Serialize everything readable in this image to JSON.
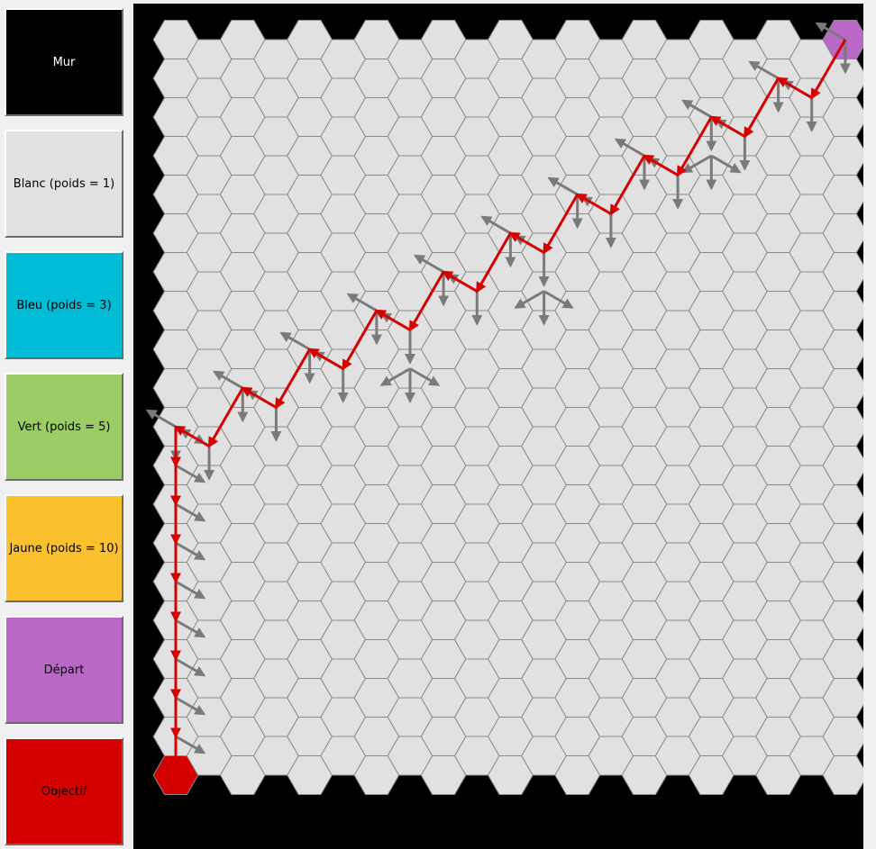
{
  "palette": {
    "buttons": [
      {
        "label": "Mur",
        "bg": "#000000",
        "fg": "#ffffff"
      },
      {
        "label": "Blanc (poids = 1)",
        "bg": "#e1e1e1",
        "fg": "#000000"
      },
      {
        "label": "Bleu (poids = 3)",
        "bg": "#00bcd6",
        "fg": "#000000"
      },
      {
        "label": "Vert (poids = 5)",
        "bg": "#9ccc65",
        "fg": "#000000"
      },
      {
        "label": "Jaune (poids = 10)",
        "bg": "#fbc02d",
        "fg": "#000000"
      },
      {
        "label": "Départ",
        "bg": "#ba68c8",
        "fg": "#000000"
      },
      {
        "label": "Objectif",
        "bg": "#d50000",
        "fg": "#000000"
      }
    ]
  },
  "colors": {
    "cell_fill": "#e1e1e1",
    "cell_border": "#8a8a8a",
    "board_bg": "#000000",
    "start": "#ba68c8",
    "goal": "#d50000",
    "path": "#d60000",
    "explore_arrow": "#7a7a7a"
  }
}
